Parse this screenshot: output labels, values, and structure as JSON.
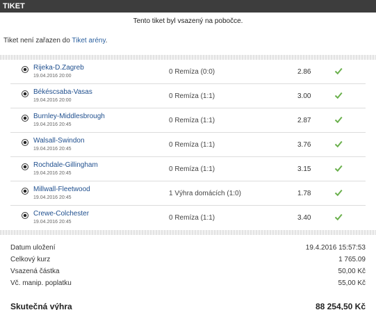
{
  "header": {
    "title": "TIKET"
  },
  "notice": "Tento tiket byl vsazený na pobočce.",
  "arena": {
    "prefix": "Tiket není zařazen do ",
    "link": "Tiket arény",
    "suffix": "."
  },
  "bets": [
    {
      "match": "Rijeka-D.Zagreb",
      "time": "19.04.2016 20:00",
      "pick": "0 Remíza (0:0)",
      "odds": "2.86"
    },
    {
      "match": "Békéscsaba-Vasas",
      "time": "19.04.2016 20:00",
      "pick": "0 Remíza (1:1)",
      "odds": "3.00"
    },
    {
      "match": "Burnley-Middlesbrough",
      "time": "19.04.2016 20:45",
      "pick": "0 Remíza (1:1)",
      "odds": "2.87"
    },
    {
      "match": "Walsall-Swindon",
      "time": "19.04.2016 20:45",
      "pick": "0 Remíza (1:1)",
      "odds": "3.76"
    },
    {
      "match": "Rochdale-Gillingham",
      "time": "19.04.2016 20:45",
      "pick": "0 Remíza (1:1)",
      "odds": "3.15"
    },
    {
      "match": "Millwall-Fleetwood",
      "time": "19.04.2016 20:45",
      "pick": "1 Výhra domácích (1:0)",
      "odds": "1.78"
    },
    {
      "match": "Crewe-Colchester",
      "time": "19.04.2016 20:45",
      "pick": "0 Remíza (1:1)",
      "odds": "3.40"
    }
  ],
  "summary": {
    "saved_label": "Datum uložení",
    "saved_value": "19.4.2016 15:57:53",
    "rate_label": "Celkový kurz",
    "rate_value": "1 765.09",
    "stake_label": "Vsazená částka",
    "stake_value": "50,00 Kč",
    "fee_label": "Vč. manip. poplatku",
    "fee_value": "55,00 Kč",
    "win_label": "Skutečná výhra",
    "win_value": "88 254,50 Kč"
  },
  "colors": {
    "header_bg": "#3d3d3d",
    "link": "#1f4f8e",
    "check": "#6ab04c"
  },
  "icons": {
    "sport": "football-icon",
    "result": "checkmark-icon"
  }
}
